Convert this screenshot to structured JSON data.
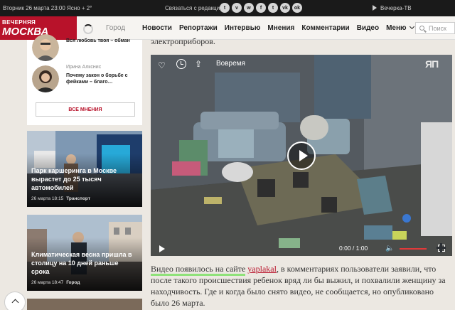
{
  "topbar": {
    "date": "Вторник 26 марта 23:00   Ясно + 2°",
    "contact": "Связаться с редакцией",
    "socials": [
      "telegram-icon",
      "viber-icon",
      "whatsapp-icon",
      "facebook-icon",
      "twitter-icon",
      "vk-icon",
      "odnoklassniki-icon"
    ],
    "socials_glyphs": [
      "t",
      "v",
      "w",
      "f",
      "t",
      "vk",
      "ok"
    ],
    "tv": "Вечерка-ТВ"
  },
  "nav": {
    "logo_top": "ВЕЧЕРНЯЯ",
    "logo_bottom": "МОСКВА",
    "city": "Город",
    "items": [
      "Новости",
      "Репортажи",
      "Интервью",
      "Мнения",
      "Комментарии",
      "Видео",
      "Меню"
    ],
    "search_placeholder": "Поиск"
  },
  "opinions": {
    "items": [
      {
        "name": "",
        "title": "Вся любовь твоя – обман"
      },
      {
        "name": "Ирина Алкснис",
        "title": "Почему закон о борьбе с фейками – благо…"
      }
    ],
    "all_button": "ВСЕ МНЕНИЯ"
  },
  "news": [
    {
      "headline": "Парк каршеринга в Москве вырастет до 25 тысяч автомобилей",
      "date": "26 марта 18:15",
      "rubric": "Транспорт"
    },
    {
      "headline": "Климатическая весна пришла в столицу на 10 дней раньше срока",
      "date": "26 марта 18:47",
      "rubric": "Город"
    }
  ],
  "article": {
    "top_text": "электроприборов.",
    "video": {
      "title": "Вовремя",
      "logo": "ЯП",
      "time": "0:00 / 1:00"
    },
    "para_hl": "Видео появилось на сайте",
    "link": "yaplakal",
    "para_rest": ", в комментариях пользователи заявили, что после такого происшествия ребенок вряд ли бы выжил, и похвалили женщину за находчивость. Где и когда было снято видео, не сообщается, но опубликовано было 26 марта."
  }
}
